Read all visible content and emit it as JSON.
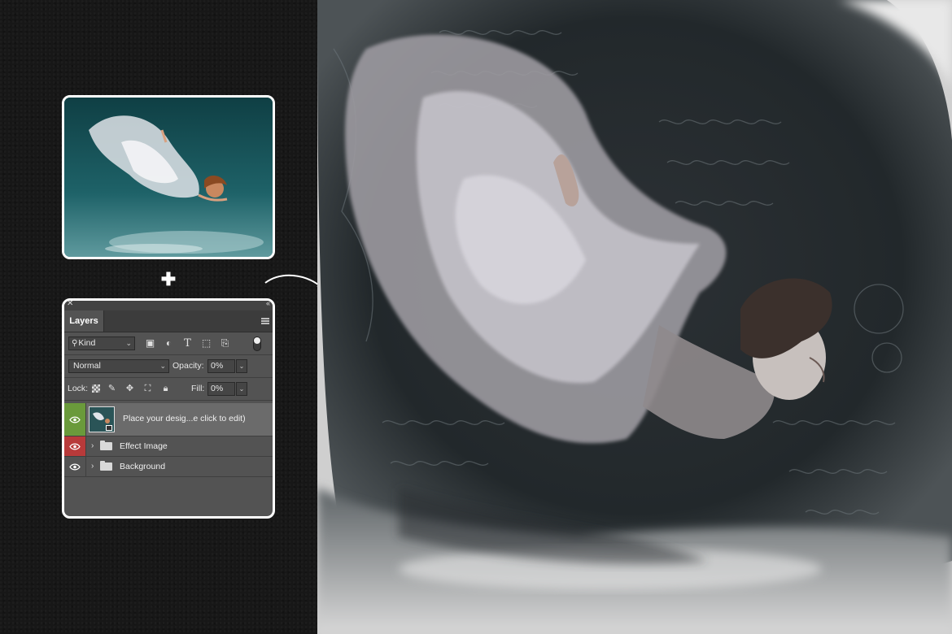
{
  "layers_panel": {
    "tab_label": "Layers",
    "filter": {
      "kind_label": "Kind"
    },
    "blend_mode": "Normal",
    "opacity_label": "Opacity:",
    "opacity_value": "0%",
    "lock_label": "Lock:",
    "fill_label": "Fill:",
    "fill_value": "0%",
    "layers": [
      {
        "name": "Place your desig...e click to edit)",
        "type": "smart-object",
        "eye_color": "#6a9a3b",
        "selected": true
      },
      {
        "name": "Effect Image",
        "type": "group",
        "eye_color": "#b83a3a",
        "selected": false
      },
      {
        "name": "Background",
        "type": "group",
        "eye_color": null,
        "selected": false
      }
    ]
  },
  "icons": {
    "plus": "plus-icon",
    "arrow": "curved-arrow-icon",
    "filter_icons": [
      "image-filter-icon",
      "adjustment-filter-icon",
      "type-filter-icon",
      "shape-filter-icon",
      "smart-object-filter-icon"
    ],
    "lock_icons": [
      "lock-transparent-icon",
      "lock-paint-icon",
      "lock-position-icon",
      "lock-artboard-icon",
      "lock-all-icon"
    ]
  },
  "colors": {
    "panel_bg": "#535353",
    "selected_layer": "#6b6b6b",
    "eye_green": "#6a9a3b",
    "eye_red": "#b83a3a",
    "page_bg": "#161616"
  }
}
